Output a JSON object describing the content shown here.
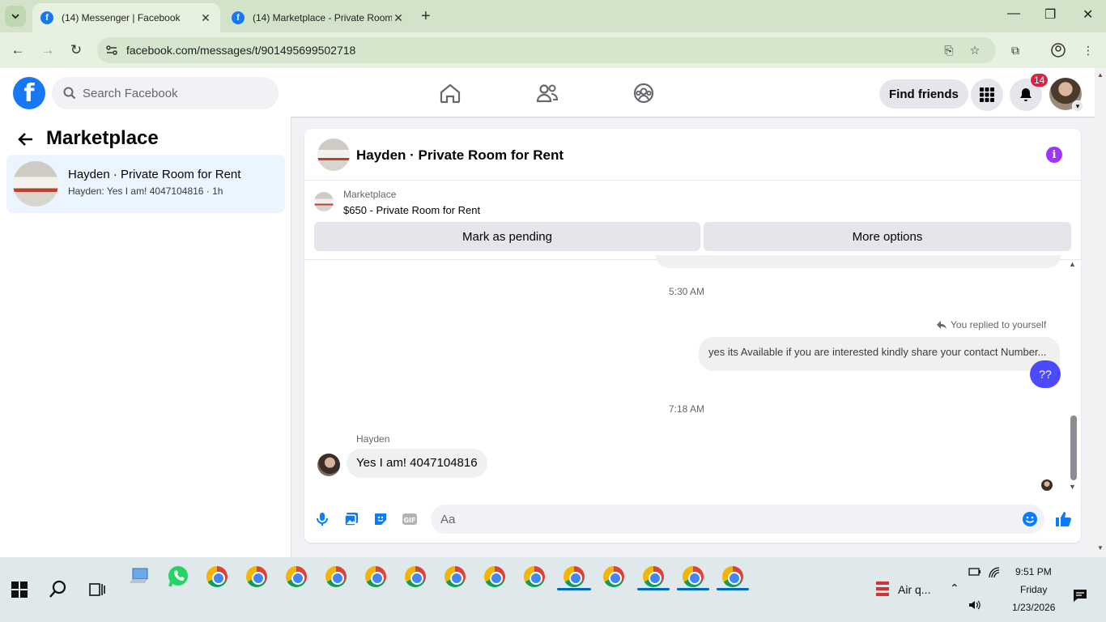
{
  "browser": {
    "tabs": [
      {
        "title": "(14) Messenger | Facebook",
        "active": true
      },
      {
        "title": "(14) Marketplace - Private Room",
        "active": false
      }
    ],
    "url": "facebook.com/messages/t/901495699502718"
  },
  "fb_header": {
    "search_placeholder": "Search Facebook",
    "find_friends": "Find friends",
    "notification_count": "14",
    "brand_color": "#1877f2"
  },
  "left_panel": {
    "title": "Marketplace",
    "conversations": [
      {
        "name": "Hayden · Private Room for Rent",
        "preview": "Hayden: Yes I am! 4047104816 · 1h"
      }
    ]
  },
  "chat": {
    "title": "Hayden · Private Room for Rent",
    "marketplace_label": "Marketplace",
    "listing": "$650 - Private Room for Rent",
    "mark_pending": "Mark as pending",
    "more_options": "More options",
    "messages": {
      "time1": "5:30 AM",
      "replied_note": "You replied to yourself",
      "out_text": "yes its Available if you are interested kindly share your contact Number...",
      "out_short": "??",
      "time2": "7:18 AM",
      "sender": "Hayden",
      "in_text": "Yes I am! 4047104816"
    },
    "composer_placeholder": "Aa"
  },
  "taskbar": {
    "weather": "Air q...",
    "time": "9:51 PM",
    "day": "Friday",
    "date": "1/23/2026"
  }
}
